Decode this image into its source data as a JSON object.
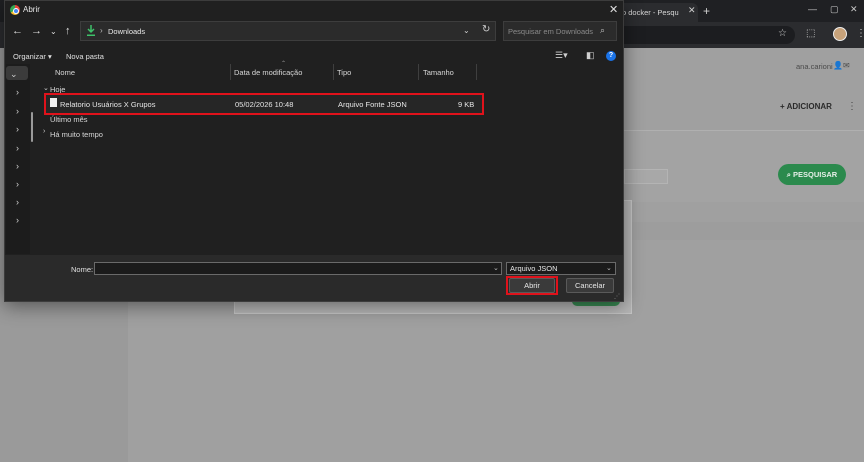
{
  "browser": {
    "tab_title": "o docker - Pesqu",
    "new_tab": "+",
    "min": "—",
    "max": "▢",
    "close": "✕",
    "page": {
      "user_name": "ana.carioni",
      "add_button": "+ ADICIONAR",
      "search_button": "PESQUISAR"
    }
  },
  "dialog": {
    "title": "Abrir",
    "path": "Downloads",
    "search_placeholder": "Pesquisar em Downloads",
    "toolbar": {
      "organize": "Organizar",
      "new_folder": "Nova pasta"
    },
    "columns": {
      "name": "Nome",
      "modified": "Data de modificação",
      "type": "Tipo",
      "size": "Tamanho"
    },
    "groups": {
      "today": "Hoje",
      "last_month": "Último mês",
      "long_ago": "Há muito tempo"
    },
    "file": {
      "name": "Relatorio Usuários X Grupos",
      "modified": "05/02/2026 10:48",
      "type": "Arquivo Fonte JSON",
      "size": "9 KB"
    },
    "footer": {
      "name_label": "Nome:",
      "name_value": "",
      "filetype": "Arquivo JSON",
      "open_button": "Abrir",
      "cancel_button": "Cancelar"
    }
  },
  "colors": {
    "highlight": "#e0121b",
    "dialog_bg": "#202020",
    "accent_green": "#2b8a4d"
  }
}
